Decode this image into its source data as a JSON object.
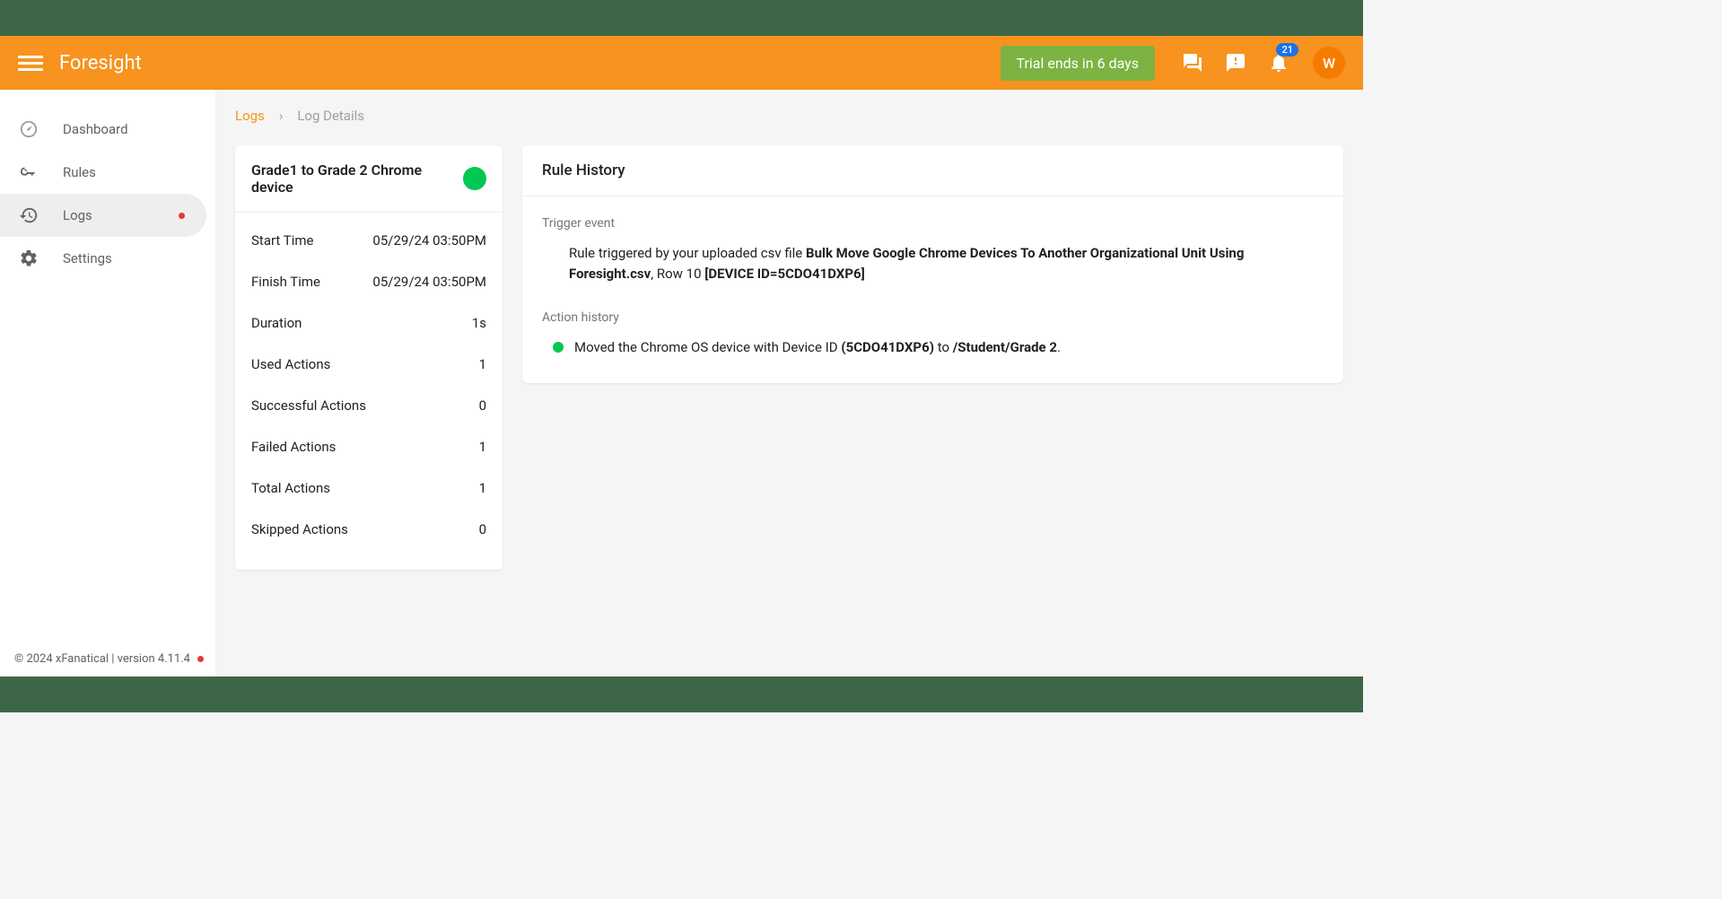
{
  "app": {
    "title": "Foresight"
  },
  "header": {
    "trial_badge": "Trial ends in 6 days",
    "notif_count": "21",
    "avatar_initial": "W"
  },
  "sidebar": {
    "items": [
      {
        "label": "Dashboard"
      },
      {
        "label": "Rules"
      },
      {
        "label": "Logs"
      },
      {
        "label": "Settings"
      }
    ],
    "footer": "© 2024 xFanatical | version 4.11.4"
  },
  "breadcrumb": {
    "link": "Logs",
    "current": "Log Details"
  },
  "summary": {
    "title": "Grade1 to Grade 2 Chrome device",
    "rows": [
      {
        "label": "Start Time",
        "value": "05/29/24 03:50PM"
      },
      {
        "label": "Finish Time",
        "value": "05/29/24 03:50PM"
      },
      {
        "label": "Duration",
        "value": "1s"
      },
      {
        "label": "Used Actions",
        "value": "1"
      },
      {
        "label": "Successful Actions",
        "value": "0"
      },
      {
        "label": "Failed Actions",
        "value": "1"
      },
      {
        "label": "Total Actions",
        "value": "1"
      },
      {
        "label": "Skipped Actions",
        "value": "0"
      }
    ]
  },
  "history": {
    "title": "Rule History",
    "trigger_label": "Trigger event",
    "trigger_prefix": "Rule triggered by your uploaded csv file ",
    "trigger_file": "Bulk Move Google Chrome Devices To Another Organizational Unit Using Foresight.csv",
    "trigger_mid": ", Row 10 ",
    "trigger_device": "[DEVICE ID=5CDO41DXP6]",
    "action_label": "Action history",
    "action_prefix": "Moved the Chrome OS device with Device ID ",
    "action_device": "(5CDO41DXP6)",
    "action_mid": " to ",
    "action_path": "/Student/Grade 2",
    "action_suffix": "."
  }
}
